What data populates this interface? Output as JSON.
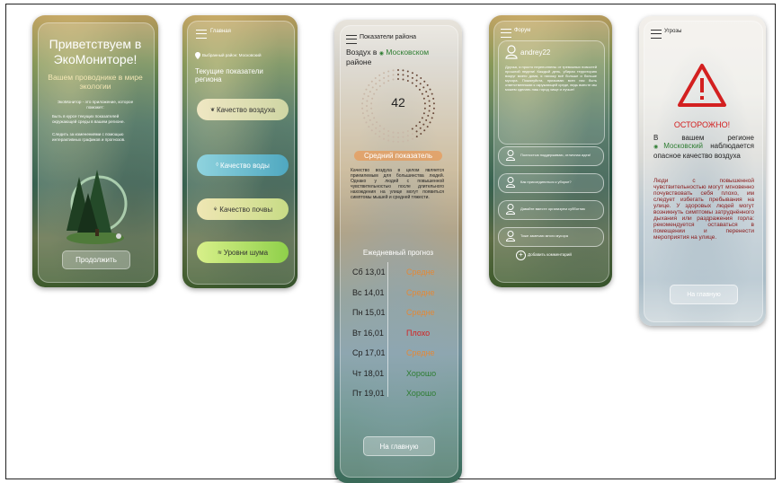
{
  "screens": {
    "welcome": {
      "title": "Приветствуем в ЭкоМониторе!",
      "subtitle": "Вашем проводнике в мире экологии",
      "intro": "ЭкоМонитор - это приложение, которое поможет:",
      "bullets": [
        "Быть в курсе текущих показателей окружающей среды в вашем регионе.",
        "Следить за изменениями с помощью интерактивных графиков и прогнозов."
      ],
      "continue_button": "Продолжить"
    },
    "home": {
      "menu_title": "Главная",
      "region_line": "Выбранный район: Московский",
      "section_title": "Текущие показатели региона",
      "buttons": [
        "Качество воздуха",
        "Качество воды",
        "Качество почвы",
        "Уровни шума"
      ]
    },
    "indicators": {
      "menu_title": "Показатели района",
      "heading_prefix": "Воздух в",
      "heading_region": "Московском",
      "heading_suffix": "районе",
      "gauge_value": "42",
      "gauge_fraction": 0.42,
      "status": "Средний показатель",
      "description": "Качество воздуха в целом является приемлемым для большинства людей. Однако у людей с повышенной чувствительностью после длительного нахождения на улице могут появиться симптомы мышей и средней тяжести.",
      "forecast_title": "Ежедневный прогноз",
      "forecast": [
        {
          "day": "Сб 13,01",
          "value": "Средне",
          "color": "#e0893a"
        },
        {
          "day": "Вс 14,01",
          "value": "Средне",
          "color": "#e0893a"
        },
        {
          "day": "Пн 15,01",
          "value": "Средне",
          "color": "#e0893a"
        },
        {
          "day": "Вт 16,01",
          "value": "Плохо",
          "color": "#d32020"
        },
        {
          "day": "Ср 17,01",
          "value": "Средне",
          "color": "#e0893a"
        },
        {
          "day": "Чт 18,01",
          "value": "Хорошо",
          "color": "#2e7d32"
        },
        {
          "day": "Пт 19,01",
          "value": "Хорошо",
          "color": "#2e7d32"
        }
      ],
      "home_button": "На главную"
    },
    "forum": {
      "menu_title": "Форум",
      "user": "andrey22",
      "post": "Друзья, я просто переполнены от тревожных новостей прошлой недели! Каждый день, убирая территорию вокруг моего дома, я нахожу всё больше и больше мусора. Пожалуйста, призываю всех нас быть ответственными к окружающей среде, ведь вместе мы можем сделать наш город чище и лучше!",
      "comments": [
        "Полностью поддерживаю, отличная идея!",
        "Как присоединиться к уборке?",
        "Давайте вместе организуем субботник",
        "Тоже замечаю много мусора"
      ],
      "add_comment": "Добавить комментарий"
    },
    "threats": {
      "menu_title": "Угрозы",
      "alert_title": "ОСТОРОЖНО!",
      "alert_line1": "В вашем регионе",
      "alert_region": "Московский",
      "alert_line2": "наблюдается опасное качество воздуха",
      "advice": "Люди с повышенной чувствительностью могут мгновенно почувствовать себя плохо, им следует избегать пребывания на улице. У здоровых людей могут возникнуть симптомы затруднённого дыхания или раздражения горла: рекомендуется оставаться в помещении и перенести мероприятия на улице.",
      "home_button": "На главную"
    }
  },
  "colors": {
    "accent_orange": "#e0893a",
    "danger_red": "#d32020",
    "good_green": "#2e7d32"
  },
  "icons": [
    "menu-icon",
    "location-pin-icon",
    "user-icon",
    "plus-icon",
    "warning-icon",
    "tree-icon"
  ]
}
